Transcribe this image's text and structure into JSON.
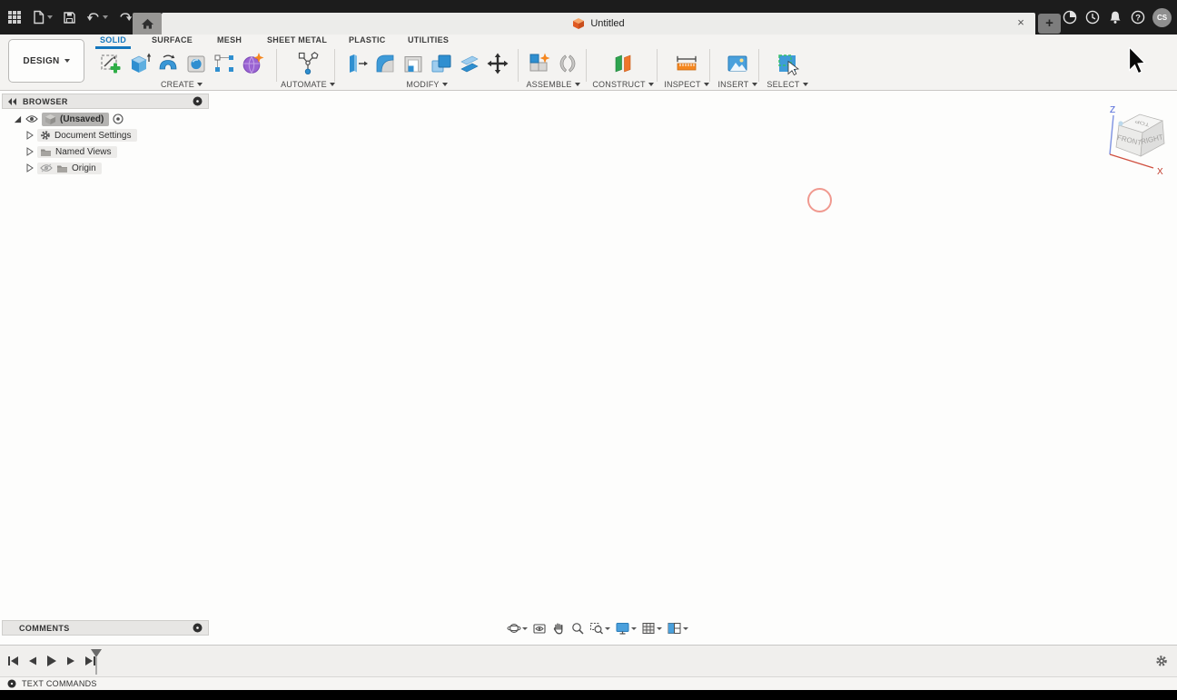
{
  "colors": {
    "accent_blue": "#1376bd",
    "icon_blue": "#2f8fd0",
    "icon_blue_light": "#9fcdee",
    "titlebar_bg": "#1c1c1c",
    "toolbar_bg": "#f4f3f1",
    "canvas_bg": "#fdfdfc",
    "click_indicator": "#f0998f",
    "star_orange": "#f5871f",
    "construct_green": "#2ea44f",
    "construct_orange": "#f0762b",
    "document_cube_orange": "#e8632c"
  },
  "titlebar": {
    "icons_left": [
      "app-grid",
      "file-new",
      "save",
      "undo",
      "redo",
      "home"
    ],
    "document_tab": {
      "title": "Untitled",
      "close_label": "×"
    },
    "new_tab_label": "+",
    "icons_right": [
      "extensions",
      "job-status",
      "notifications",
      "help",
      "avatar"
    ],
    "avatar_initials": "CS"
  },
  "ribbon": {
    "design_label": "DESIGN",
    "tabs": [
      {
        "label": "SOLID",
        "active": true
      },
      {
        "label": "SURFACE",
        "active": false
      },
      {
        "label": "MESH",
        "active": false
      },
      {
        "label": "SHEET METAL",
        "active": false
      },
      {
        "label": "PLASTIC",
        "active": false
      },
      {
        "label": "UTILITIES",
        "active": false
      }
    ],
    "groups": [
      {
        "label": "CREATE",
        "tools": [
          "create-sketch",
          "extrude",
          "revolve",
          "hole",
          "rectangular-pattern",
          "create-form"
        ]
      },
      {
        "label": "AUTOMATE",
        "tools": [
          "automation"
        ]
      },
      {
        "label": "MODIFY",
        "tools": [
          "press-pull",
          "fillet",
          "shell",
          "combine",
          "offset-face",
          "move"
        ]
      },
      {
        "label": "ASSEMBLE",
        "tools": [
          "new-component",
          "joint"
        ]
      },
      {
        "label": "CONSTRUCT",
        "tools": [
          "construction-plane"
        ]
      },
      {
        "label": "INSPECT",
        "tools": [
          "measure"
        ]
      },
      {
        "label": "INSERT",
        "tools": [
          "insert-image"
        ]
      },
      {
        "label": "SELECT",
        "tools": [
          "select"
        ]
      }
    ]
  },
  "browser": {
    "title": "BROWSER",
    "root_label": "(Unsaved)",
    "items": [
      "Document Settings",
      "Named Views",
      "Origin"
    ]
  },
  "viewcube": {
    "faces": [
      "TOP",
      "FRONT",
      "RIGHT"
    ],
    "axes": [
      "Z",
      "X"
    ]
  },
  "display_bar": {
    "icons": [
      "orbit",
      "look-at",
      "pan",
      "zoom",
      "window-zoom",
      "display-settings",
      "grid-snaps",
      "viewports"
    ]
  },
  "comments": {
    "title": "COMMENTS"
  },
  "timeline": {
    "controls": [
      "skip-to-start",
      "step-back",
      "play",
      "step-forward",
      "skip-to-end"
    ]
  },
  "text_commands": {
    "label": "TEXT COMMANDS"
  }
}
